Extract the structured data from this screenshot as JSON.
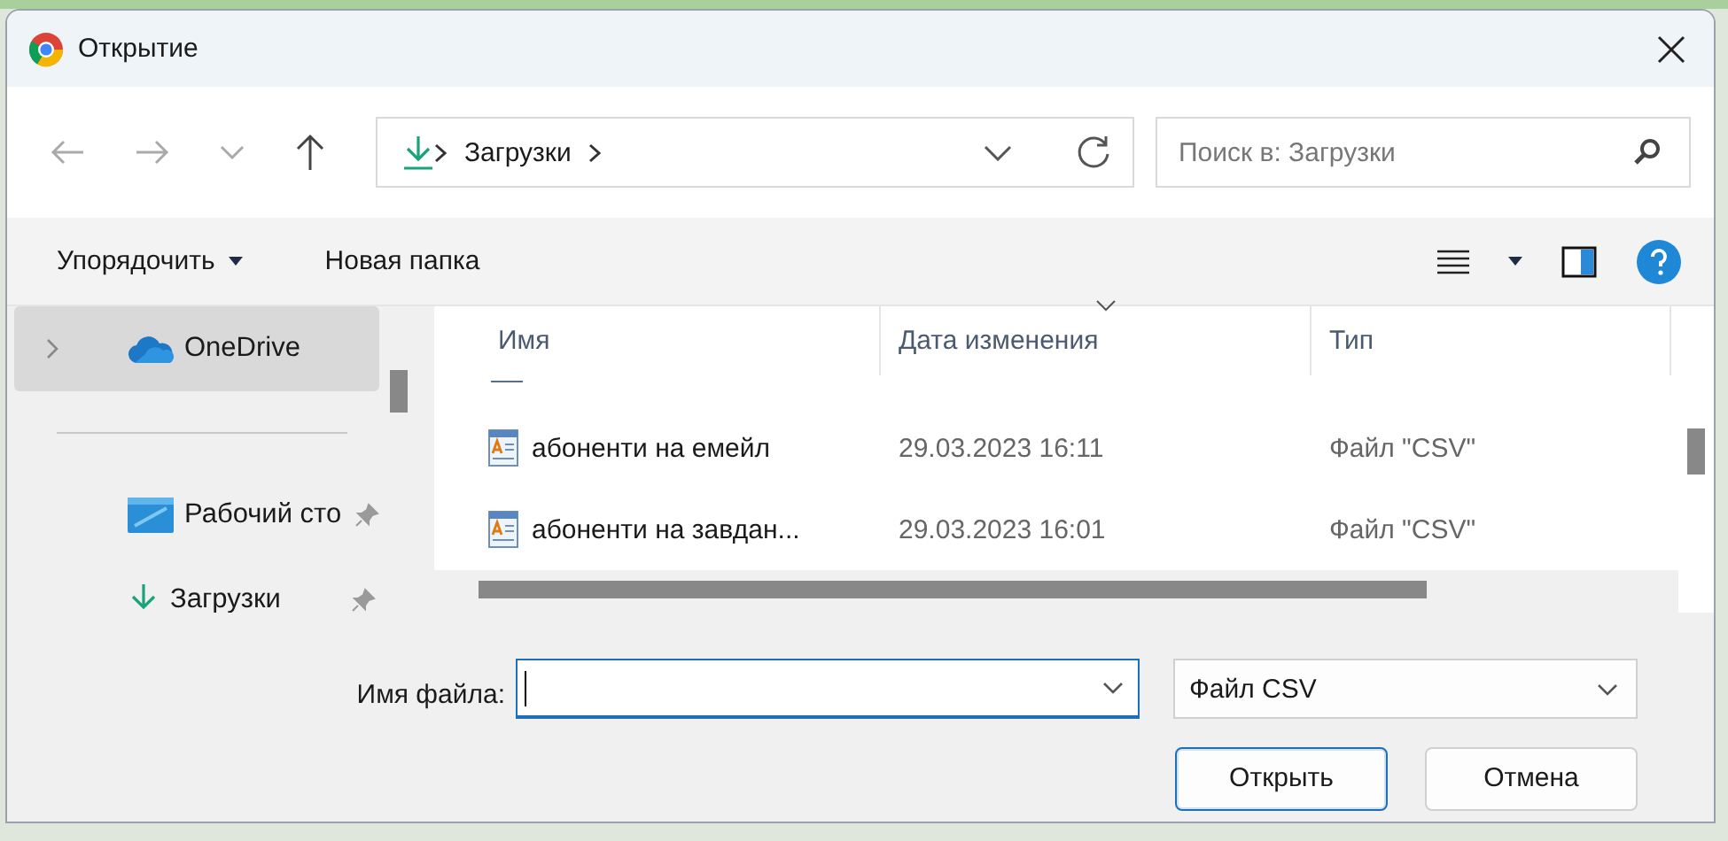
{
  "window": {
    "title": "Открытие"
  },
  "address": {
    "path": [
      "Загрузки"
    ]
  },
  "search": {
    "placeholder": "Поиск в: Загрузки"
  },
  "toolbar": {
    "organize": "Упорядочить",
    "new_folder": "Новая папка"
  },
  "sidebar": {
    "items": [
      {
        "label": "OneDrive",
        "kind": "cloud",
        "selected": true,
        "pinned": false
      },
      {
        "kind": "divider"
      },
      {
        "label": "Рабочий сто",
        "kind": "desktop",
        "selected": false,
        "pinned": true
      },
      {
        "label": "Загрузки",
        "kind": "download",
        "selected": false,
        "pinned": true
      }
    ]
  },
  "table": {
    "columns": [
      {
        "label": "Имя",
        "sorted": false
      },
      {
        "label": "Дата изменения",
        "sorted": true
      },
      {
        "label": "Тип",
        "sorted": false
      }
    ],
    "rows": [
      {
        "name": "абоненти на емейл",
        "date": "29.03.2023 16:11",
        "type": "Файл \"CSV\""
      },
      {
        "name": "абоненти на завдан...",
        "date": "29.03.2023 16:01",
        "type": "Файл \"CSV\""
      }
    ]
  },
  "file_name": {
    "label": "Имя файла:"
  },
  "file_type": {
    "value": "Файл CSV"
  },
  "buttons": [
    {
      "label": "Открыть",
      "default": true
    },
    {
      "label": "Отмена",
      "default": false
    }
  ]
}
